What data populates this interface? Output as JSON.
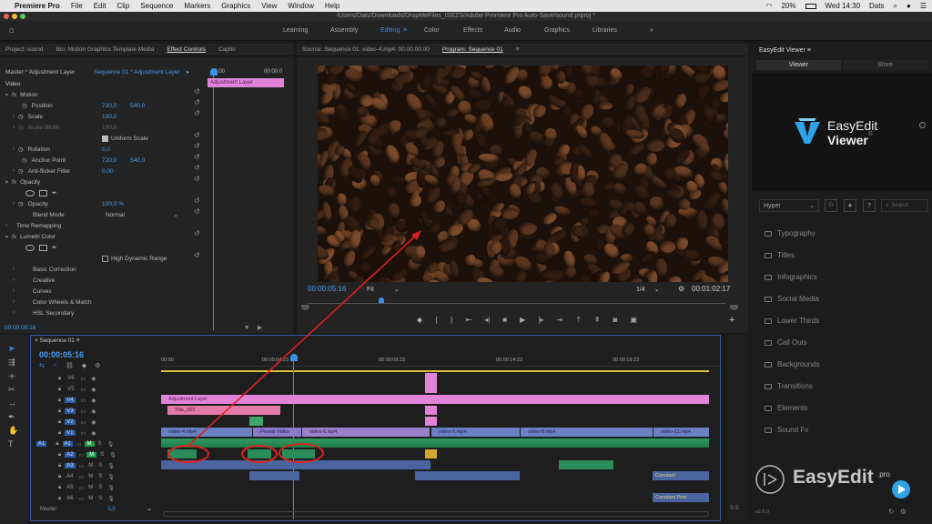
{
  "macbar": {
    "app": "Premiere Pro",
    "menus": [
      "File",
      "Edit",
      "Clip",
      "Sequence",
      "Markers",
      "Graphics",
      "View",
      "Window",
      "Help"
    ],
    "battery": "20%",
    "clock": "Wed 14:30",
    "user": "Dats"
  },
  "window_title": "/Users/Dats/Downloads/DropMeFiles_ISEZS/Adobe Premiere Pro Auto-Save/sound.prproj *",
  "workspaces": [
    "Learning",
    "Assembly",
    "Editing",
    "Color",
    "Effects",
    "Audio",
    "Graphics",
    "Libraries"
  ],
  "workspace_active": "Editing",
  "left_tabs": [
    "Project: sound",
    "Bin: Motion Graphics Template Media",
    "Effect Controls",
    "Captio"
  ],
  "effect_controls": {
    "master_label": "Master * Adjustment Layer",
    "sequence_label": "Sequence 01 * Adjustment Layer",
    "timecode_start": "00:00",
    "timecode_mid": "00:00:0",
    "clip_label": "Adjustment Layer",
    "section_video": "Video",
    "motion": "Motion",
    "position": {
      "label": "Position",
      "x": "720,0",
      "y": "540,0"
    },
    "scale": {
      "label": "Scale",
      "value": "100,0"
    },
    "scale_width": {
      "label": "Scale Width",
      "value": "100,0"
    },
    "uniform_scale": "Uniform Scale",
    "rotation": {
      "label": "Rotation",
      "value": "0,0"
    },
    "anchor": {
      "label": "Anchor Point",
      "x": "720,0",
      "y": "540,0"
    },
    "antiflicker": {
      "label": "Anti-flicker Filter",
      "value": "0,00"
    },
    "opacity_group": "Opacity",
    "opacity": {
      "label": "Opacity",
      "value": "100,0 %"
    },
    "blend_mode": {
      "label": "Blend Mode",
      "value": "Normal"
    },
    "time_remap": "Time Remapping",
    "lumetri": "Lumetri Color",
    "hdr": "High Dynamic Range",
    "lumetri_items": [
      "Basic Correction",
      "Creative",
      "Curves",
      "Color Wheels & Match",
      "HSL Secondary"
    ],
    "bottom_timecode": "00:00:05:16"
  },
  "source_tab": "Source: Sequence 01: video-4.mp4: 00:00:00:00",
  "program_tab": "Program: Sequence 01",
  "program": {
    "timecode": "00:00:05:16",
    "fit": "Fit",
    "resolution": "1/4",
    "duration": "00:01:02:17"
  },
  "timeline": {
    "tab": "Sequence 01",
    "timecode": "00:00:05:16",
    "ruler": [
      "00:00",
      "00:00:04:23",
      "00:00:09:23",
      "00:00:14:23",
      "00:00:19:23"
    ],
    "video_tracks": [
      "V6",
      "V5",
      "V4",
      "V3",
      "V2",
      "V1"
    ],
    "audio_tracks": [
      "A1",
      "A2",
      "A3",
      "A4",
      "A5",
      "A6"
    ],
    "master_label": "Master",
    "master_value": "0,0",
    "src_patch_a": "A1",
    "clips": {
      "adjustment": "Adjustment Layer",
      "title": "Title_055",
      "v1": [
        "video-4.mp4",
        "Pexels Video",
        "video-6.mp4",
        "video-5.mp4",
        "video-8.mp4",
        "video-11.mp4"
      ],
      "sound1": "Constant",
      "sound2": "Constant Pow"
    }
  },
  "eev": {
    "title": "EasyEdit Viewer",
    "tabs": [
      "Viewer",
      "Store"
    ],
    "brand_line1": "EasyEdit",
    "brand_line2": "Viewer",
    "brand_mark": "©",
    "filter": "Hyper",
    "search_placeholder": "Search",
    "categories": [
      "Typography",
      "Titles",
      "Infographics",
      "Social Media",
      "Lower Thirds",
      "Call Outs",
      "Backgrounds",
      "Transitions",
      "Elements",
      "Sound Fx"
    ],
    "version": "v2.6.0",
    "watermark": "EasyEdit",
    "watermark_suffix": ".pro"
  },
  "colors": {
    "accent": "#3d8ee6",
    "adjustment_clip": "#e184d8",
    "title_clip": "#e37aa8",
    "video_clip": "#6a80c2",
    "audio_clip": "#2a8c5a",
    "annotation": "#e02020"
  }
}
